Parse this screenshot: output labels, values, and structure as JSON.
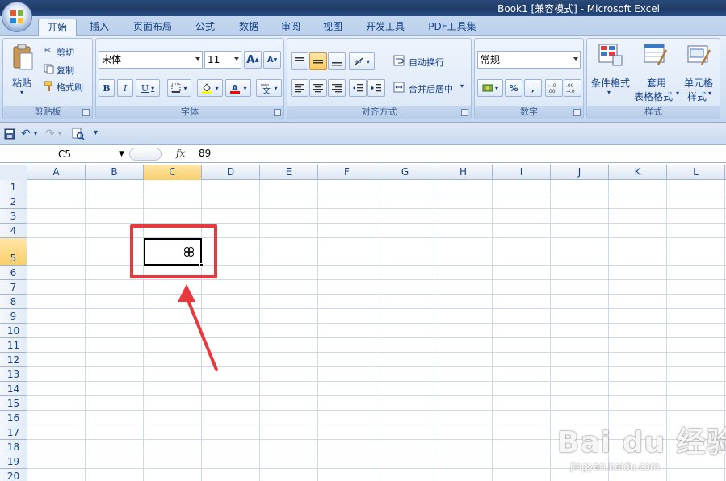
{
  "window": {
    "title": "Book1  [兼容模式] - Microsoft Excel"
  },
  "tabs": [
    "开始",
    "插入",
    "页面布局",
    "公式",
    "数据",
    "审阅",
    "视图",
    "开发工具",
    "PDF工具集"
  ],
  "clipboard": {
    "paste": "粘贴",
    "cut": "剪切",
    "copy": "复制",
    "format_painter": "格式刷",
    "label": "剪贴板"
  },
  "font": {
    "name": "宋体",
    "size": "11",
    "bold": "B",
    "italic": "I",
    "underline": "U",
    "label": "字体",
    "grow": "A",
    "shrink": "A"
  },
  "alignment": {
    "wrap": "自动换行",
    "merge": "合并后居中",
    "label": "对齐方式"
  },
  "number": {
    "format": "常规",
    "percent": "%",
    "comma": ",",
    "label": "数字"
  },
  "styles": {
    "conditional_1": "条件格式",
    "table_1": "套用",
    "table_2": "表格格式",
    "cell_1": "单元格",
    "cell_2": "样式",
    "label": "样式"
  },
  "formula_bar": {
    "cell_ref": "C5",
    "fx": "fx",
    "formula": "89"
  },
  "columns": [
    "A",
    "B",
    "C",
    "D",
    "E",
    "F",
    "G",
    "H",
    "I",
    "J",
    "K",
    "L"
  ],
  "rows": [
    "1",
    "2",
    "3",
    "4",
    "5",
    "6",
    "7",
    "8",
    "9",
    "10",
    "11",
    "12",
    "13",
    "14",
    "15",
    "16",
    "17",
    "18",
    "19",
    "20"
  ],
  "selected": {
    "column": "C",
    "row": "5"
  },
  "watermark": {
    "brand": "Bai du 经验",
    "url": "jingyan.baidu.com"
  },
  "colors": {
    "accent": "#e8393f",
    "ribbon": "#d3e1f3",
    "selection": "#f9cf6b"
  }
}
